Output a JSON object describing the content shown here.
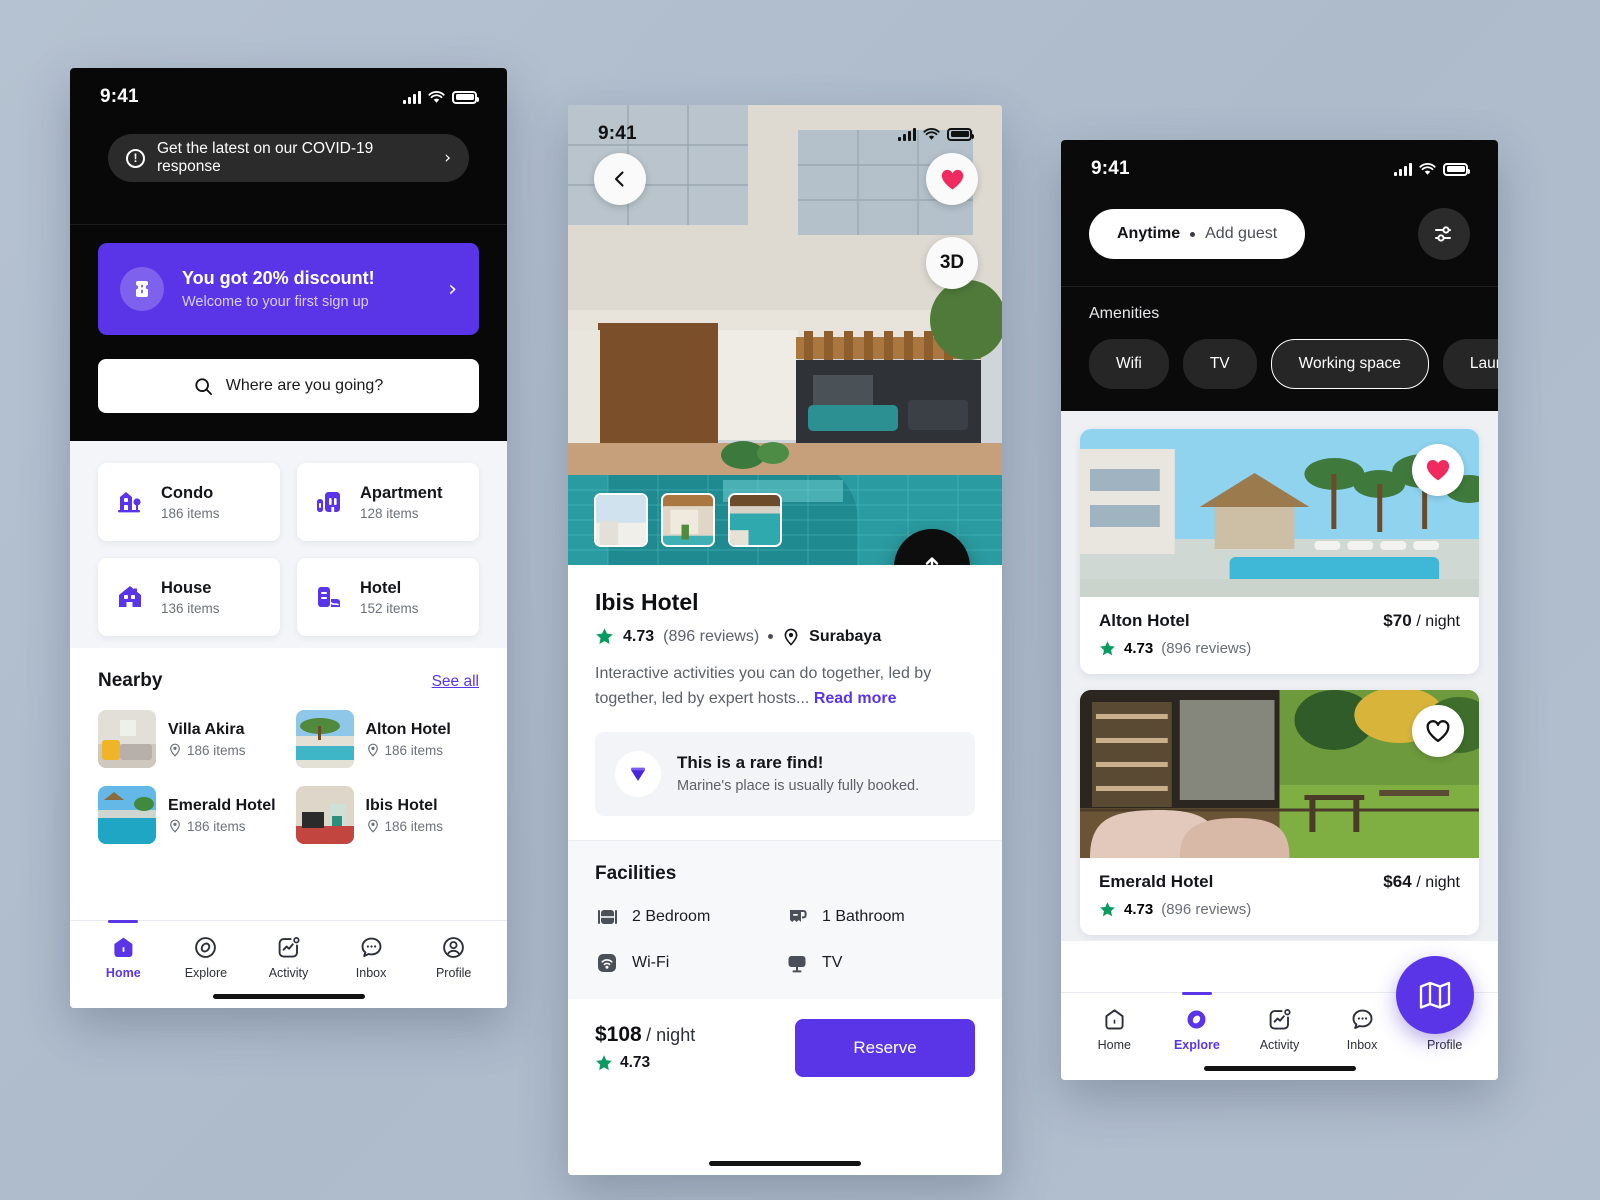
{
  "status_bar": {
    "time": "9:41"
  },
  "screen_home": {
    "covid_banner": {
      "label": "Get the latest on our COVID-19 response",
      "icon": "info-icon",
      "chevron": "›"
    },
    "promo": {
      "title": "You got 20% discount!",
      "subtitle": "Welcome to your first sign up",
      "icon": "ticket-icon",
      "chevron": "›",
      "color": "#5a35e8"
    },
    "search": {
      "placeholder": "Where are you going?",
      "icon": "search-icon"
    },
    "categories": [
      {
        "name": "Condo",
        "items": "186 items",
        "icon": "condo-icon"
      },
      {
        "name": "Apartment",
        "items": "128 items",
        "icon": "apartment-icon"
      },
      {
        "name": "House",
        "items": "136 items",
        "icon": "house-icon"
      },
      {
        "name": "Hotel",
        "items": "152 items",
        "icon": "hotel-icon"
      }
    ],
    "nearby": {
      "title": "Nearby",
      "see_all": "See all",
      "items": [
        {
          "name": "Villa Akira",
          "items": "186 items"
        },
        {
          "name": "Alton Hotel",
          "items": "186 items"
        },
        {
          "name": "Emerald Hotel",
          "items": "186 items"
        },
        {
          "name": "Ibis Hotel",
          "items": "186 items"
        }
      ]
    },
    "tabs": [
      {
        "label": "Home",
        "icon": "home-icon",
        "active": true
      },
      {
        "label": "Explore",
        "icon": "explore-icon",
        "active": false
      },
      {
        "label": "Activity",
        "icon": "activity-icon",
        "active": false
      },
      {
        "label": "Inbox",
        "icon": "inbox-icon",
        "active": false
      },
      {
        "label": "Profile",
        "icon": "profile-icon",
        "active": false
      }
    ]
  },
  "screen_detail": {
    "back_icon": "chevron-left-icon",
    "favorite_icon": "heart-filled-icon",
    "badge_3d": "3D",
    "share_icon": "share-upload-icon",
    "title": "Ibis Hotel",
    "rating": "4.73",
    "reviews": "(896 reviews)",
    "location": "Surabaya",
    "description": "Interactive activities you can do together, led by together, led by expert hosts...",
    "read_more": "Read more",
    "rare": {
      "title": "This is a rare find!",
      "subtitle": "Marine's place is usually fully booked.",
      "icon": "diamond-icon"
    },
    "facilities_title": "Facilities",
    "facilities": [
      {
        "label": "2 Bedroom",
        "icon": "bed-icon"
      },
      {
        "label": "1 Bathroom",
        "icon": "bath-icon"
      },
      {
        "label": "Wi-Fi",
        "icon": "wifi-icon"
      },
      {
        "label": "TV",
        "icon": "tv-icon"
      }
    ],
    "price": "$108",
    "price_unit": "/ night",
    "price_rating": "4.73",
    "reserve_label": "Reserve"
  },
  "screen_explore": {
    "search_pill": {
      "when": "Anytime",
      "guests": "Add guest"
    },
    "filter_icon": "filter-sliders-icon",
    "amenities_label": "Amenities",
    "amenity_chips": [
      {
        "label": "Wifi",
        "selected": false
      },
      {
        "label": "TV",
        "selected": false
      },
      {
        "label": "Working space",
        "selected": true
      },
      {
        "label": "Laundry",
        "selected": false
      }
    ],
    "listings": [
      {
        "name": "Alton Hotel",
        "price": "$70",
        "price_unit": "/ night",
        "rating": "4.73",
        "reviews": "(896 reviews)",
        "favorite": true
      },
      {
        "name": "Emerald Hotel",
        "price": "$64",
        "price_unit": "/ night",
        "rating": "4.73",
        "reviews": "(896 reviews)",
        "favorite": false
      }
    ],
    "map_fab_icon": "map-icon",
    "tabs": [
      {
        "label": "Home",
        "icon": "home-icon",
        "active": false
      },
      {
        "label": "Explore",
        "icon": "explore-icon",
        "active": true
      },
      {
        "label": "Activity",
        "icon": "activity-icon",
        "active": false
      },
      {
        "label": "Inbox",
        "icon": "inbox-icon",
        "active": false
      },
      {
        "label": "Profile",
        "icon": "profile-icon",
        "active": false
      }
    ]
  },
  "theme": {
    "accent": "#5a35e8",
    "star_green": "#0a9b62",
    "heart_pink": "#ee2a5f",
    "page_bg": "#b0bece"
  }
}
